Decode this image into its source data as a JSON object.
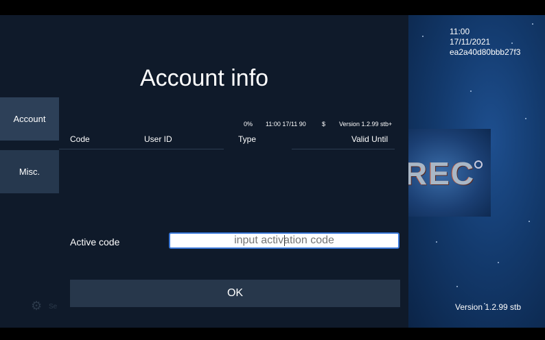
{
  "dialog": {
    "title": "Account info",
    "tabs": [
      {
        "label": "Account"
      },
      {
        "label": "Misc."
      }
    ],
    "status": {
      "progress": "0%",
      "datetime": "11:00 17/11 90",
      "currency": "$",
      "version": "Version 1.2.99 stb+"
    },
    "table": {
      "columns": [
        "Code",
        "User ID",
        "Type",
        "Valid Until"
      ]
    },
    "active_code": {
      "label": "Active code",
      "placeholder": "input activation code"
    },
    "ok_label": "OK",
    "gear_label": "Se"
  },
  "side": {
    "time": "11:00",
    "date": "17/11/2021",
    "device_id": "ea2a40d80bbb27f3",
    "logo_text": "REC",
    "version": "Version 1.2.99 stb"
  },
  "colors": {
    "dialog_bg": "#0f1a2a",
    "tab_bg": "#26384e",
    "button_bg": "#27374b",
    "input_border": "#3a78d8"
  }
}
